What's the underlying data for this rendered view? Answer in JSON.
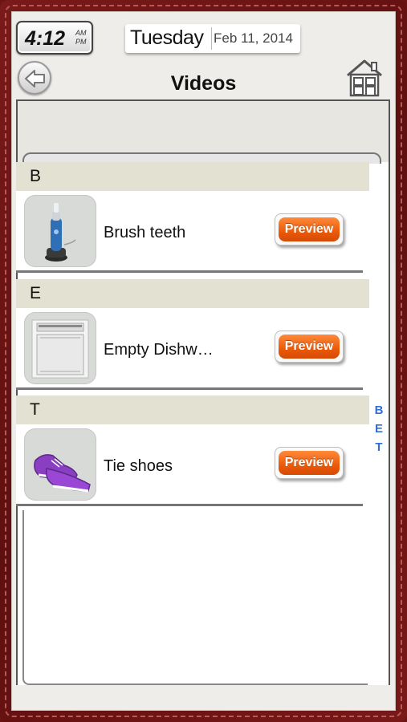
{
  "clock": {
    "time": "4:12",
    "am": "AM",
    "pm": "PM"
  },
  "date": {
    "weekday": "Tuesday",
    "full": "Feb 11, 2014"
  },
  "header": {
    "title": "Videos",
    "back_icon": "back-arrow-icon",
    "home_icon": "home-icon"
  },
  "sections": [
    {
      "letter": "B",
      "items": [
        {
          "label": "Brush teeth",
          "icon": "toothbrush-icon",
          "button": "Preview"
        }
      ]
    },
    {
      "letter": "E",
      "items": [
        {
          "label": "Empty Dishw…",
          "icon": "dishwasher-icon",
          "button": "Preview"
        }
      ]
    },
    {
      "letter": "T",
      "items": [
        {
          "label": "Tie shoes",
          "icon": "shoe-icon",
          "button": "Preview"
        }
      ]
    }
  ],
  "index_letters": [
    "B",
    "E",
    "T"
  ],
  "colors": {
    "frame": "#6b1414",
    "accent": "#ea5a0a",
    "index": "#2e6fd6",
    "section_bg": "#e3e1d2"
  }
}
